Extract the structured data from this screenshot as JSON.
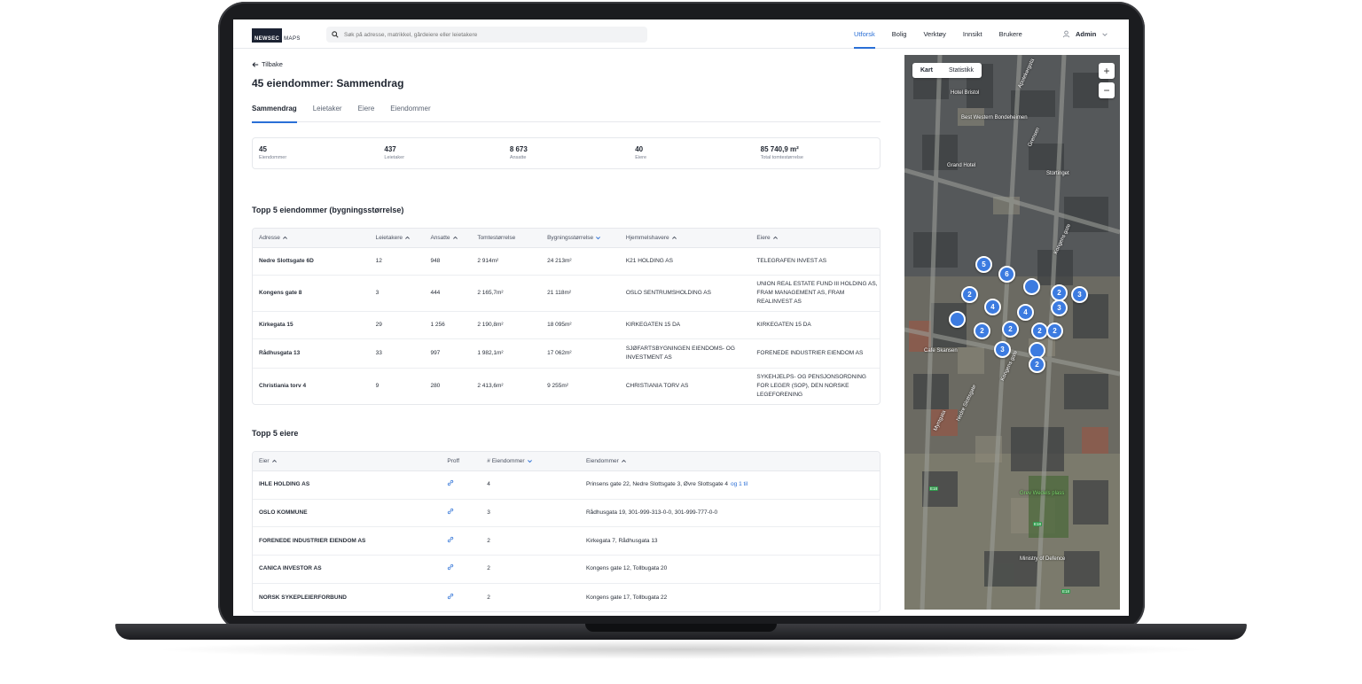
{
  "app": {
    "logo_primary": "NEWSEC",
    "logo_secondary": "MAPS"
  },
  "search": {
    "placeholder": "Søk på adresse, matrikkel, gårdeiere eller leietakere"
  },
  "nav": {
    "items": [
      {
        "label": "Utforsk",
        "active": true
      },
      {
        "label": "Bolig"
      },
      {
        "label": "Verktøy"
      },
      {
        "label": "Innsikt"
      },
      {
        "label": "Brukere"
      }
    ],
    "user_label": "Admin"
  },
  "page": {
    "back_label": "Tilbake",
    "title": "45 eiendommer: Sammendrag",
    "tabs": [
      "Sammendrag",
      "Leietaker",
      "Eiere",
      "Eiendommer"
    ],
    "active_tab": "Sammendrag"
  },
  "stats": [
    {
      "value": "45",
      "label": "Eiendommer"
    },
    {
      "value": "437",
      "label": "Leietaker"
    },
    {
      "value": "8 673",
      "label": "Ansatte"
    },
    {
      "value": "40",
      "label": "Eiere"
    },
    {
      "value": "85 740,9 m²",
      "label": "Total tomtestørrelse"
    }
  ],
  "top_properties": {
    "title": "Topp 5 eiendommer (bygningsstørrelse)",
    "columns": [
      "Adresse",
      "Leietakere",
      "Ansatte",
      "Tomtestørrelse",
      "Bygningsstørrelse",
      "Hjemmelshavere",
      "Eiere"
    ],
    "rows": [
      [
        "Nedre Slottsgate 6D",
        "12",
        "948",
        "2 914m²",
        "24 213m²",
        "K21 HOLDING AS",
        "TELEGRAFEN INVEST AS"
      ],
      [
        "Kongens gate 8",
        "3",
        "444",
        "2 165,7m²",
        "21 118m²",
        "OSLO SENTRUMSHOLDING AS",
        "UNION REAL ESTATE FUND III HOLDING AS, FRAM MANAGEMENT AS, FRAM REALINVEST AS"
      ],
      [
        "Kirkegata 15",
        "29",
        "1 256",
        "2 190,8m²",
        "18 095m²",
        "KIRKEGATEN 15 DA",
        "KIRKEGATEN 15 DA"
      ],
      [
        "Rådhusgata 13",
        "33",
        "997",
        "1 982,1m²",
        "17 062m²",
        "SJØFARTSBYGNINGEN EIENDOMS- OG INVESTMENT AS",
        "FORENEDE INDUSTRIER EIENDOM AS"
      ],
      [
        "Christiania torv 4",
        "9",
        "280",
        "2 413,6m²",
        "9 255m²",
        "CHRISTIANIA TORV AS",
        "SYKEHJELPS- OG PENSJONSORDNING FOR LEGER (SOP), DEN NORSKE LEGEFORENING"
      ]
    ]
  },
  "top_owners": {
    "title": "Topp 5 eiere",
    "columns": [
      "Eier",
      "Proff",
      "# Eiendommer",
      "Eiendommer"
    ],
    "more_label": "og 1 til",
    "rows": [
      [
        "IHLE HOLDING AS",
        "4",
        "Prinsens gate 22, Nedre Slottsgate 3, Øvre Slottsgate 4"
      ],
      [
        "OSLO KOMMUNE",
        "3",
        "Rådhusgata 19, 301-999-313-0-0, 301-999-777-0-0"
      ],
      [
        "FORENEDE INDUSTRIER EIENDOM AS",
        "2",
        "Kirkegata 7, Rådhusgata 13"
      ],
      [
        "CANICA INVESTOR AS",
        "2",
        "Kongens gate 12, Tollbugata 20"
      ],
      [
        "NORSK SYKEPLEIERFORBUND",
        "2",
        "Kongens gate 17, Tollbugata 22"
      ]
    ]
  },
  "map": {
    "toggle": [
      "Kart",
      "Statistikk"
    ],
    "zoom_in": "+",
    "zoom_out": "−",
    "clusters": [
      "5",
      "6",
      "2",
      "4",
      "",
      "2",
      "3",
      "3",
      "4",
      "",
      "2",
      "2",
      "2",
      "2",
      "3",
      "",
      "2"
    ],
    "labels": [
      "Apotekergata",
      "Hotel Bristol",
      "Best Western Bondeheimen",
      "Grand Hotel",
      "Stortinget",
      "Cafe Skansen",
      "Kongens gate",
      "Myntgata",
      "Nedre Slottsgate",
      "Grev Wedels plass",
      "Ministry of Defence",
      "Grensen",
      "Kongens gate"
    ],
    "route_signs": [
      "E18",
      "E18",
      "E18"
    ],
    "accent_color": "#3c7be0"
  }
}
